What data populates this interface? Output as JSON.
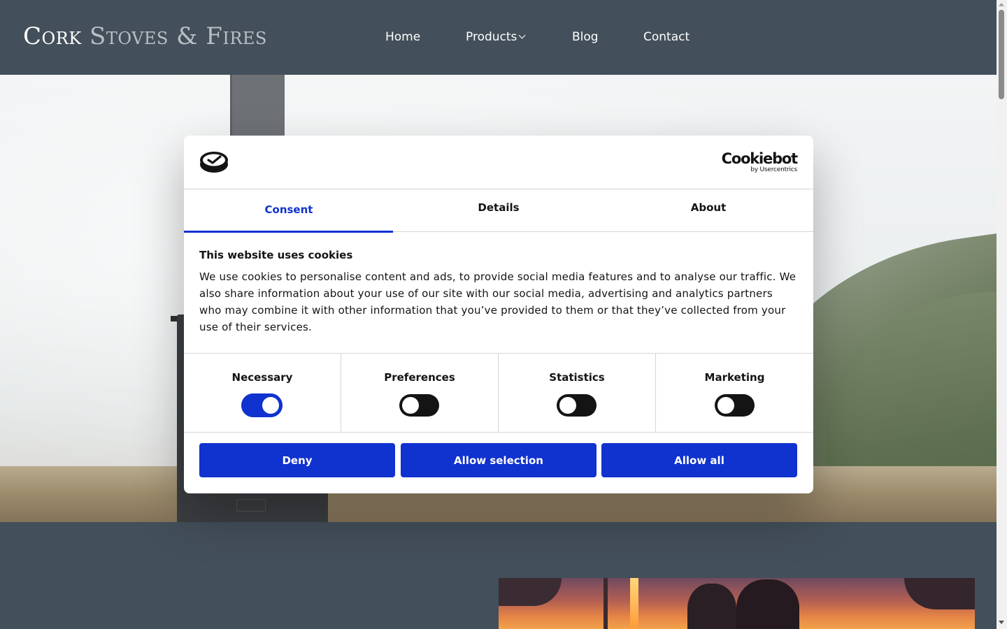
{
  "site": {
    "logo_part1": "Cork",
    "logo_part2": "Stoves & Fires",
    "nav": {
      "home": "Home",
      "products": "Products",
      "blog": "Blog",
      "contact": "Contact"
    }
  },
  "cookie_dialog": {
    "brand_name": "Cookiebot",
    "brand_sub": "by Usercentrics",
    "tabs": {
      "consent": "Consent",
      "details": "Details",
      "about": "About"
    },
    "active_tab": "Consent",
    "title": "This website uses cookies",
    "body": "We use cookies to personalise content and ads, to provide social media features and to analyse our traffic. We also share information about your use of our site with our social media, advertising and analytics partners who may combine it with other information that you’ve provided to them or that they’ve collected from your use of their services.",
    "categories": {
      "necessary": {
        "label": "Necessary",
        "enabled": true
      },
      "preferences": {
        "label": "Preferences",
        "enabled": false
      },
      "statistics": {
        "label": "Statistics",
        "enabled": false
      },
      "marketing": {
        "label": "Marketing",
        "enabled": false
      }
    },
    "buttons": {
      "deny": "Deny",
      "allow_selection": "Allow selection",
      "allow_all": "Allow all"
    },
    "accent_color": "#1032cf"
  },
  "colors": {
    "header_bg": "#434f5a",
    "dialog_bg": "#ffffff",
    "text": "#141414"
  },
  "icons": {
    "dialog_logo": "cookie-shield-icon",
    "products_dropdown": "chevron-down-icon"
  }
}
